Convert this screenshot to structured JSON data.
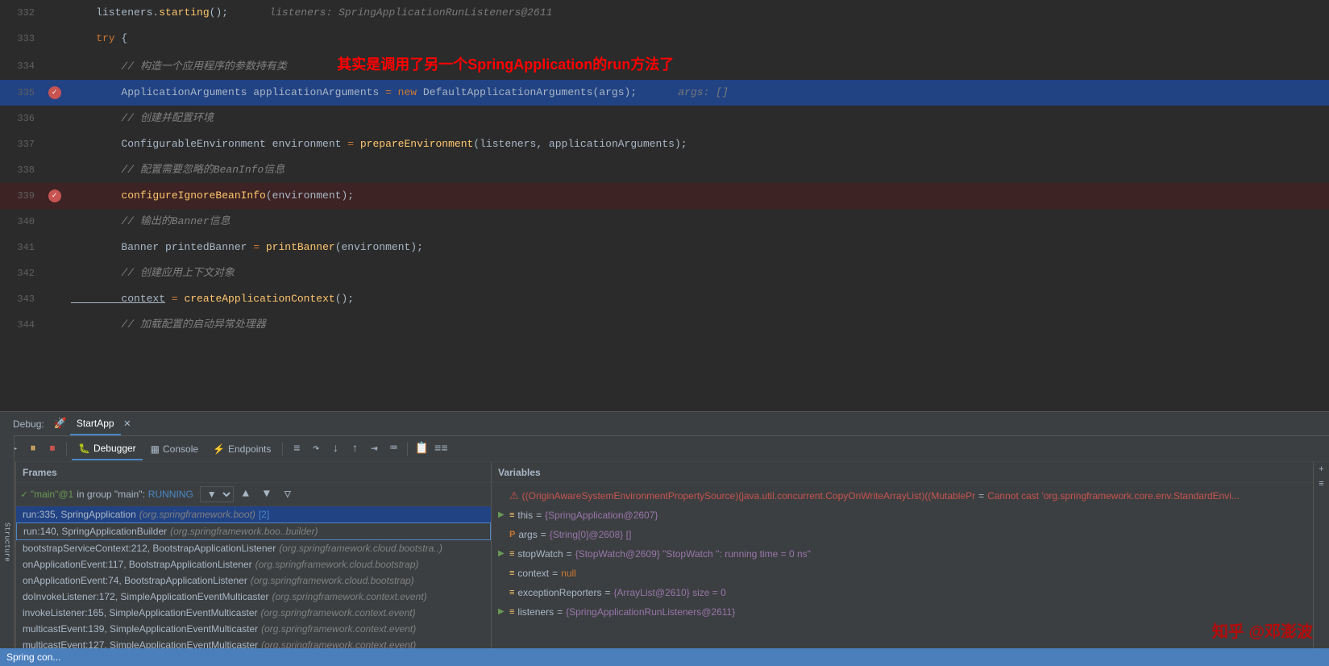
{
  "editor": {
    "lines": [
      {
        "num": 332,
        "gutter": null,
        "content_html": "    listeners.starting();",
        "hint": "listeners: SpringApplicationRunListeners@2611",
        "bg": "normal"
      },
      {
        "num": 333,
        "gutter": null,
        "content_raw": "    try {",
        "bg": "normal"
      },
      {
        "num": 334,
        "gutter": null,
        "content_raw": "        // 构造一个应用程序的参数持有类",
        "annotation": "其实是调用了另一个SpringApplication的run方法了",
        "bg": "normal"
      },
      {
        "num": 335,
        "gutter": "breakpoint-check",
        "content_raw": "        ApplicationArguments applicationArguments = new DefaultApplicationArguments(args);",
        "hint": "args: []",
        "bg": "highlighted"
      },
      {
        "num": 336,
        "gutter": null,
        "content_raw": "        // 创建并配置环境",
        "bg": "normal"
      },
      {
        "num": 337,
        "gutter": null,
        "content_raw": "        ConfigurableEnvironment environment = prepareEnvironment(listeners, applicationArguments);",
        "bg": "normal"
      },
      {
        "num": 338,
        "gutter": null,
        "content_raw": "        // 配置需要忽略的BeanInfo信息",
        "bg": "normal"
      },
      {
        "num": 339,
        "gutter": "breakpoint-check",
        "content_raw": "        configureIgnoreBeanInfo(environment);",
        "bg": "error"
      },
      {
        "num": 340,
        "gutter": null,
        "content_raw": "        // 输出的Banner信息",
        "bg": "normal"
      },
      {
        "num": 341,
        "gutter": null,
        "content_raw": "        Banner printedBanner = printBanner(environment);",
        "bg": "normal"
      },
      {
        "num": 342,
        "gutter": null,
        "content_raw": "        // 创建应用上下文对象",
        "bg": "normal"
      },
      {
        "num": 343,
        "gutter": null,
        "content_raw": "        context = createApplicationContext();",
        "bg": "normal"
      },
      {
        "num": 344,
        "gutter": null,
        "content_raw": "        // 加载配置的启动异常处理器",
        "bg": "normal"
      }
    ]
  },
  "debug": {
    "tab_label": "StartApp",
    "tabs": [
      "Debugger",
      "Console",
      "Endpoints"
    ],
    "toolbar_buttons": [
      "▶",
      "⏸",
      "⏹",
      "↺",
      "↓",
      "↑",
      "↓↓",
      "↑↑",
      "📋",
      "≡≡"
    ],
    "frames_header": "Frames",
    "thread": {
      "name": "\"main\"@1",
      "group": "group \"main\"",
      "status": "RUNNING"
    },
    "frames": [
      {
        "method": "run:335,",
        "class": "SpringApplication",
        "pkg": "(org.springframework.boot)",
        "extra": "[2]",
        "selected": true,
        "outlined": false
      },
      {
        "method": "run:140,",
        "class": "SpringApplicationBuilder",
        "pkg": "(org.springframework.boo..builder)",
        "selected": false,
        "outlined": true
      },
      {
        "method": "bootstrapServiceContext:212,",
        "class": "BootstrapApplicationListener",
        "pkg": "(org.springframework.cloud.bootstra..)",
        "selected": false,
        "outlined": false
      },
      {
        "method": "onApplicationEvent:117,",
        "class": "BootstrapApplicationListener",
        "pkg": "(org.springframework.cloud.bootstrap)",
        "selected": false
      },
      {
        "method": "onApplicationEvent:74,",
        "class": "BootstrapApplicationListener",
        "pkg": "(org.springframework.cloud.bootstrap)",
        "selected": false
      },
      {
        "method": "doInvokeListener:172,",
        "class": "SimpleApplicationEventMulticaster",
        "pkg": "(org.springframework.context.event)",
        "selected": false
      },
      {
        "method": "invokeListener:165,",
        "class": "SimpleApplicationEventMulticaster",
        "pkg": "(org.springframework.context.event)",
        "selected": false
      },
      {
        "method": "multicastEvent:139,",
        "class": "SimpleApplicationEventMulticaster",
        "pkg": "(org.springframework.context.event)",
        "selected": false
      },
      {
        "method": "multicastEvent:127,",
        "class": "SimpleApplicationEventMulticaster",
        "pkg": "(org.springframework.context.event)",
        "selected": false
      }
    ],
    "variables_header": "Variables",
    "variables": [
      {
        "type": "error",
        "expand": false,
        "icon": "⚠",
        "name": "((OriginAwareSystemEnvironmentPropertySource)(java.util.concurrent.CopyOnWriteArrayList)((MutablePr",
        "eq": "=",
        "value": "Cannot cast 'org.springframework.core.env.StandardEnvi...",
        "value_type": "error"
      },
      {
        "expand": true,
        "icon": "▶",
        "icon_color": "gray",
        "name": "this",
        "eq": "=",
        "value": "{SpringApplication@2607}",
        "value_type": "normal"
      },
      {
        "expand": false,
        "icon": "P",
        "icon_color": "purple",
        "name": "args",
        "eq": "=",
        "value": "{String[0]@2608} []",
        "value_type": "normal"
      },
      {
        "expand": true,
        "icon": "▶",
        "icon_color": "gray",
        "name": "stopWatch",
        "eq": "=",
        "value": "{StopWatch@2609} \"StopWatch '': running time = 0 ns\"",
        "value_type": "normal"
      },
      {
        "expand": false,
        "icon": "≡",
        "icon_color": "orange",
        "name": "context",
        "eq": "=",
        "value": "null",
        "value_type": "null"
      },
      {
        "expand": false,
        "icon": "≡",
        "icon_color": "orange",
        "name": "exceptionReporters",
        "eq": "=",
        "value": "{ArrayList@2610} size = 0",
        "value_type": "normal"
      },
      {
        "expand": true,
        "icon": "▶",
        "icon_color": "gray",
        "name": "listeners",
        "eq": "=",
        "value": "{SpringApplicationRunListeners@2611}",
        "value_type": "normal"
      }
    ]
  },
  "watermark": "知乎 @邓澎波",
  "bottom_bar": {
    "text": "Spring con..."
  }
}
